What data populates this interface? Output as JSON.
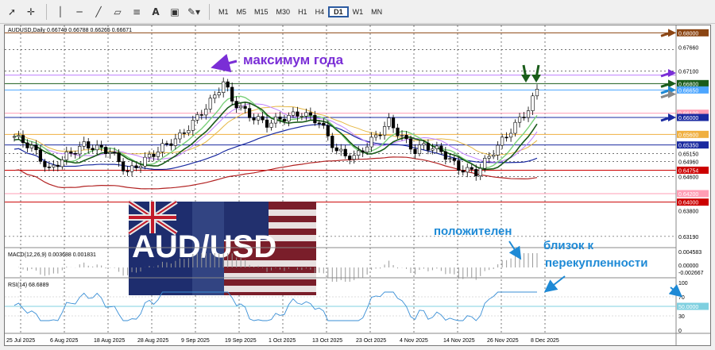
{
  "toolbar": {
    "timeframes": [
      "M1",
      "M5",
      "M15",
      "M30",
      "H1",
      "H4",
      "D1",
      "W1",
      "MN"
    ],
    "active_timeframe": "D1"
  },
  "chart_data": {
    "type": "candlestick",
    "symbol_header": "AUDUSD,Daily  0.66749 0.66788 0.66265 0.66671",
    "ylim": [
      0.63,
      0.681
    ],
    "price_labels": [
      "0.68000",
      "0.67660",
      "0.67100",
      "0.66800",
      "0.66650",
      "0.66100",
      "0.66000",
      "0.65600",
      "0.65350",
      "0.65150",
      "0.64960",
      "0.64754",
      "0.64600",
      "0.64200",
      "0.64000",
      "0.63800",
      "0.63190"
    ],
    "highlighted_levels": [
      {
        "value": "0.68000",
        "color": "#8b4513"
      },
      {
        "value": "0.67000",
        "color": "#c080ff"
      },
      {
        "value": "0.66800",
        "color": "#1a5c1a"
      },
      {
        "value": "0.66650",
        "color": "#4da6ff"
      },
      {
        "value": "0.66100",
        "color": "#ff9eb5"
      },
      {
        "value": "0.66000",
        "color": "#1a2aa0"
      },
      {
        "value": "0.65600",
        "color": "#f0b040"
      },
      {
        "value": "0.65350",
        "color": "#1a2aa0"
      },
      {
        "value": "0.64754",
        "color": "#cc0000"
      },
      {
        "value": "0.64200",
        "color": "#ff9eb5"
      },
      {
        "value": "0.64000",
        "color": "#cc0000"
      }
    ],
    "x_labels": [
      "25 Jul 2025",
      "6 Aug 2025",
      "18 Aug 2025",
      "28 Aug 2025",
      "9 Sep 2025",
      "19 Sep 2025",
      "1 Oct 2025",
      "13 Oct 2025",
      "23 Oct 2025",
      "4 Nov 2025",
      "14 Nov 2025",
      "26 Nov 2025",
      "8 Dec 2025"
    ],
    "annotations": {
      "year_high": "максимум года",
      "positive": "положителен",
      "near_overbought": "близок к перекупленности",
      "image_caption": "AUD/USD"
    },
    "macd": {
      "header": "MACD(12,26,9) 0.003688 0.001831",
      "labels": [
        "0.004583",
        "0.00000",
        "-0.002667"
      ]
    },
    "rsi": {
      "header": "RSI(14) 68.6889",
      "labels": [
        "100",
        "70",
        "50.0000",
        "30",
        "0"
      ]
    }
  }
}
